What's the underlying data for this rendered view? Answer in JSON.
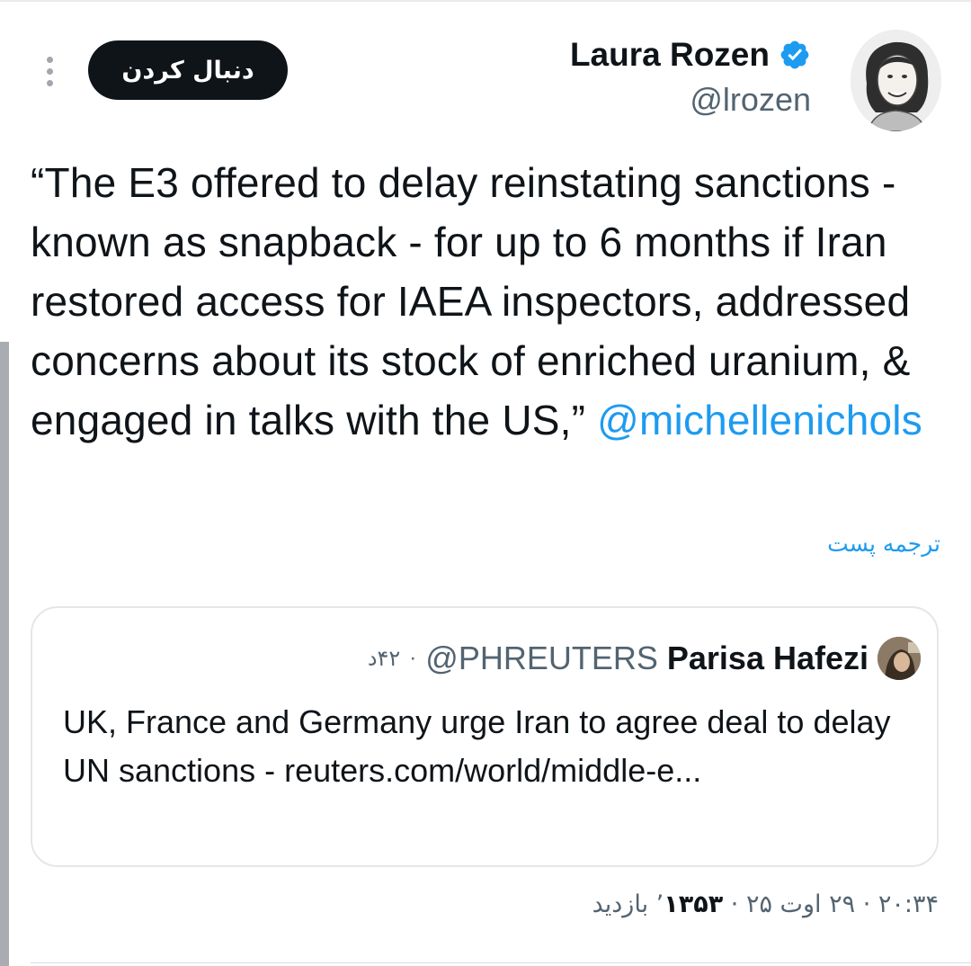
{
  "header": {
    "follow_label": "دنبال کردن",
    "author_name": "Laura Rozen",
    "author_handle": "@lrozen"
  },
  "tweet": {
    "text": "“The E3 offered to delay reinstating sanctions - known as snapback - for up to 6 months if Iran restored access for IAEA inspectors, addressed concerns about its stock of enriched uranium, & engaged in talks with the US,” ",
    "mention": "@michellenichols",
    "translate_label": "ترجمه پست"
  },
  "quote": {
    "author_name": "Parisa Hafezi",
    "author_handle": "@PHREUTERS",
    "separator": "·",
    "time": "۴۲د",
    "text": "UK, France and Germany urge Iran to agree deal to delay UN sanctions  - reuters.com/world/middle-e..."
  },
  "meta": {
    "time": "۲۰:۳۴",
    "date": "۲۹ اوت ۲۵",
    "separator": "·",
    "views_count": "۱۳۵۳",
    "views_label": "’ بازدید"
  },
  "colors": {
    "accent": "#1d9bf0",
    "text": "#0f1419",
    "muted": "#536471",
    "follow_bg": "#0f1419"
  },
  "icons": [
    "more-icon",
    "verified-badge-icon"
  ]
}
